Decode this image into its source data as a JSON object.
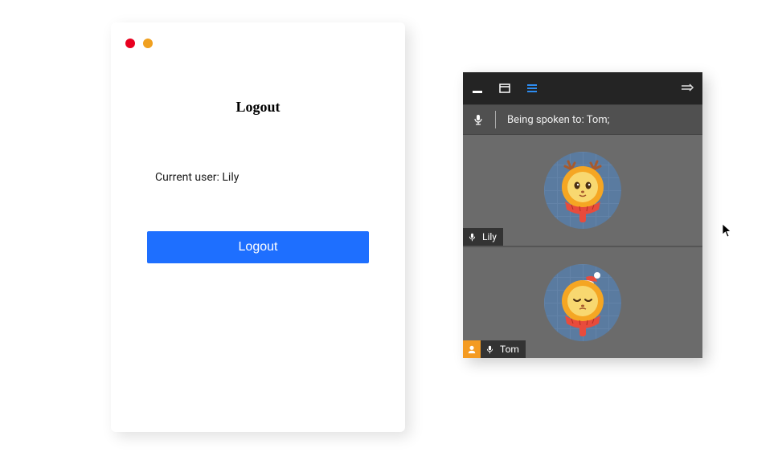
{
  "left": {
    "title": "Logout",
    "current_user_label": "Current user: Lily",
    "logout_button": "Logout"
  },
  "right": {
    "status_text": "Being spoken to: Tom;",
    "participants": [
      {
        "name": "Lily",
        "is_speaker": false
      },
      {
        "name": "Tom",
        "is_speaker": true
      }
    ]
  }
}
